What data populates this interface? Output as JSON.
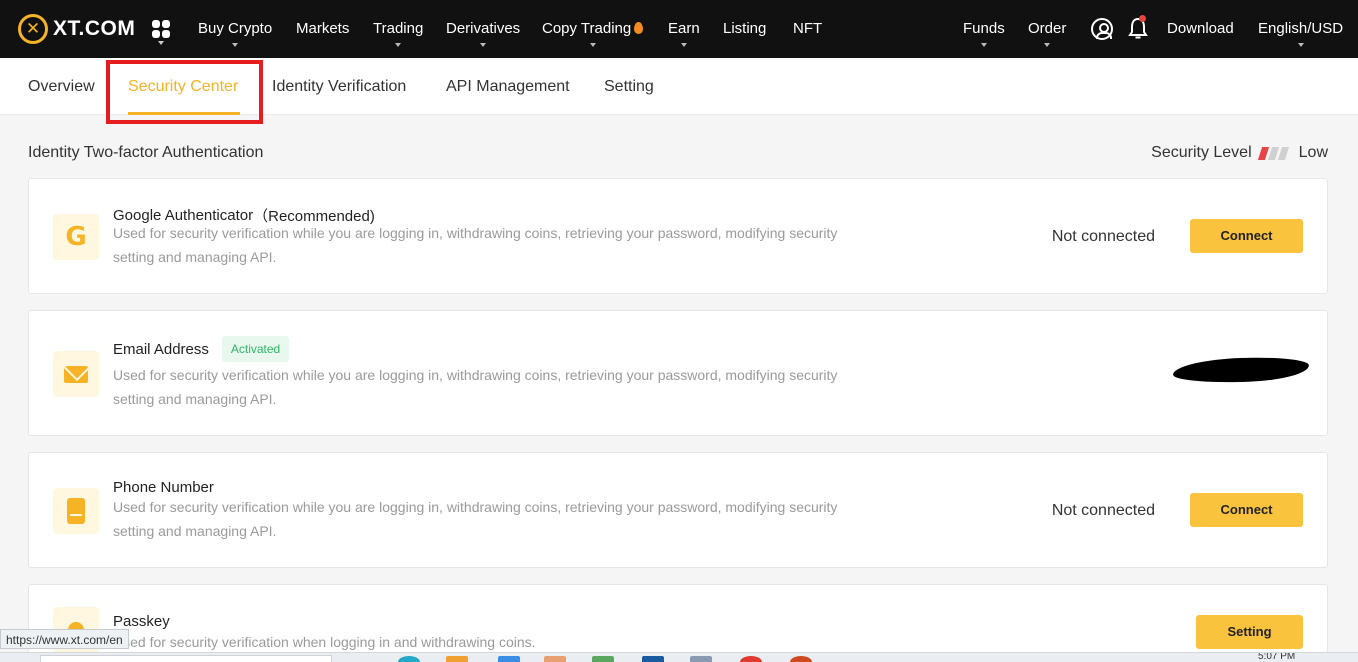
{
  "nav": {
    "logo_text": "XT.COM",
    "items": [
      {
        "label": "Buy Crypto"
      },
      {
        "label": "Markets"
      },
      {
        "label": "Trading"
      },
      {
        "label": "Derivatives"
      },
      {
        "label": "Copy Trading"
      },
      {
        "label": "Earn"
      },
      {
        "label": "Listing"
      },
      {
        "label": "NFT"
      }
    ],
    "right": {
      "funds": "Funds",
      "order": "Order",
      "download": "Download",
      "language": "English/USD"
    }
  },
  "tabs": [
    {
      "label": "Overview"
    },
    {
      "label": "Security Center"
    },
    {
      "label": "Identity Verification"
    },
    {
      "label": "API Management"
    },
    {
      "label": "Setting"
    }
  ],
  "section": {
    "title": "Identity Two-factor Authentication",
    "security_level_label": "Security Level",
    "security_level_value": "Low",
    "security_level_filled_bars": 1,
    "security_level_total_bars": 3
  },
  "cards": [
    {
      "title": "Google Authenticator",
      "title_suffix": "（Recommended)",
      "desc": "Used for security verification while you are logging in, withdrawing coins, retrieving your password, modifying security setting and managing API.",
      "status": "Not connected",
      "button": "Connect"
    },
    {
      "title": "Email Address",
      "badge": "Activated",
      "desc": "Used for security verification while you are logging in, withdrawing coins, retrieving your password, modifying security setting and managing API."
    },
    {
      "title": "Phone Number",
      "desc": "Used for security verification while you are logging in, withdrawing coins, retrieving your password, modifying security setting and managing API.",
      "status": "Not connected",
      "button": "Connect"
    },
    {
      "title": "Passkey",
      "desc": "Used for security verification when logging in and withdrawing coins.",
      "button": "Setting"
    }
  ],
  "browser": {
    "status_url": "https://www.xt.com/en",
    "clock": "5:07 PM"
  },
  "colors": {
    "accent": "#f5b325",
    "button": "#f9c33d",
    "nav_bg": "#111111",
    "highlight": "#e41e1e",
    "level_on": "#e8454a",
    "activated": "#30b464"
  }
}
